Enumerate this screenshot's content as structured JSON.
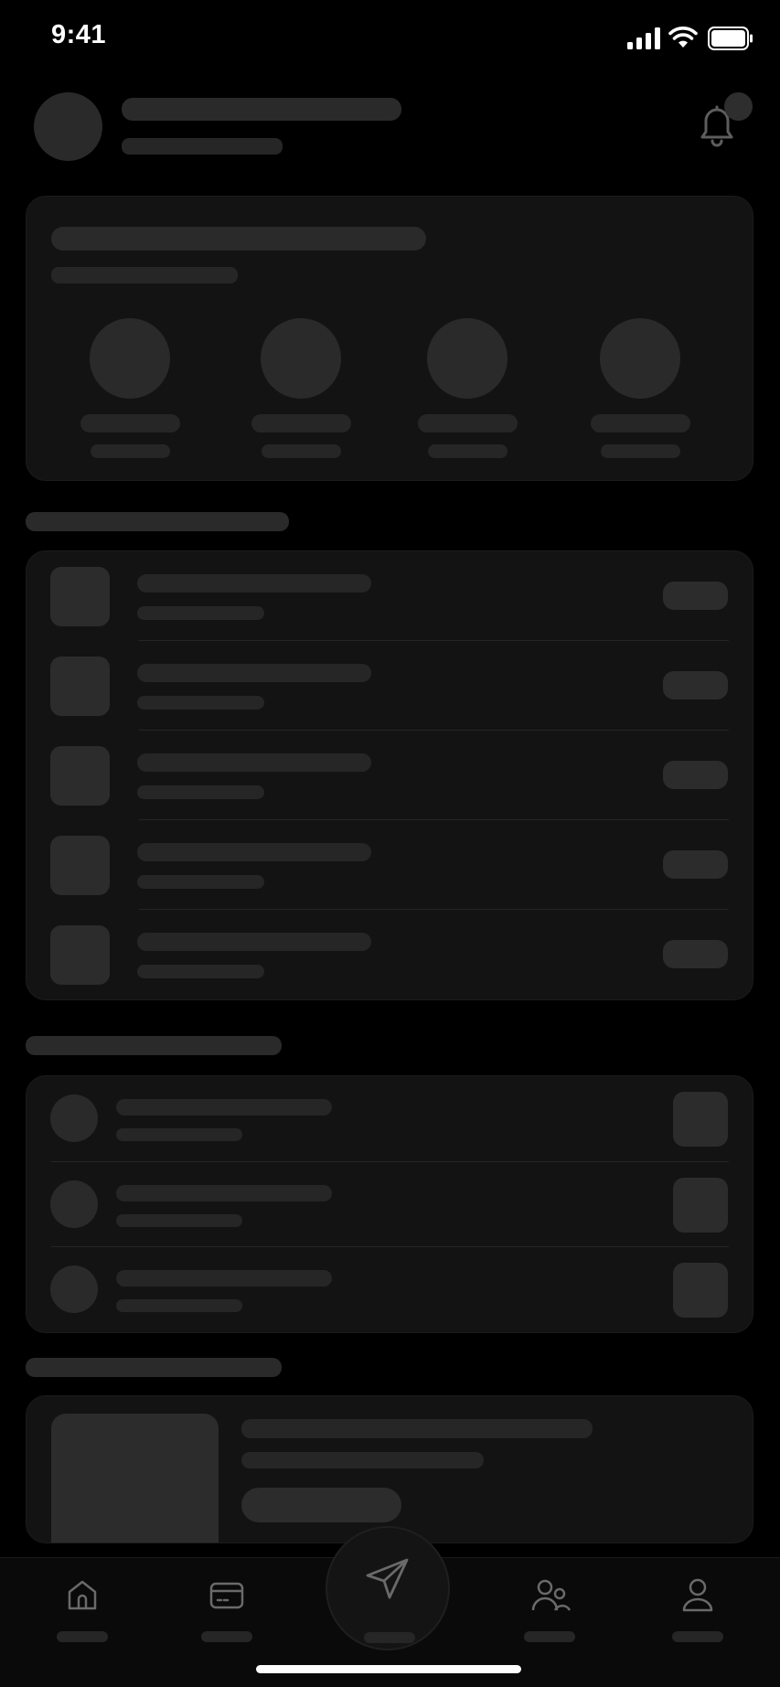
{
  "status_bar": {
    "time": "9:41"
  },
  "colors": {
    "background": "#000000",
    "card": "#131313",
    "skeleton": "#2a2a2a",
    "icon": "#6a6a6a"
  },
  "header": {
    "avatar_icon": "avatar-placeholder",
    "notification_icon": "bell-icon"
  },
  "quick_actions": {
    "count": 4
  },
  "list_one": {
    "rows": 5
  },
  "list_two": {
    "rows": 3
  },
  "tab_bar": {
    "icons": [
      "home-icon",
      "card-icon",
      "send-icon",
      "people-icon",
      "profile-icon"
    ]
  }
}
